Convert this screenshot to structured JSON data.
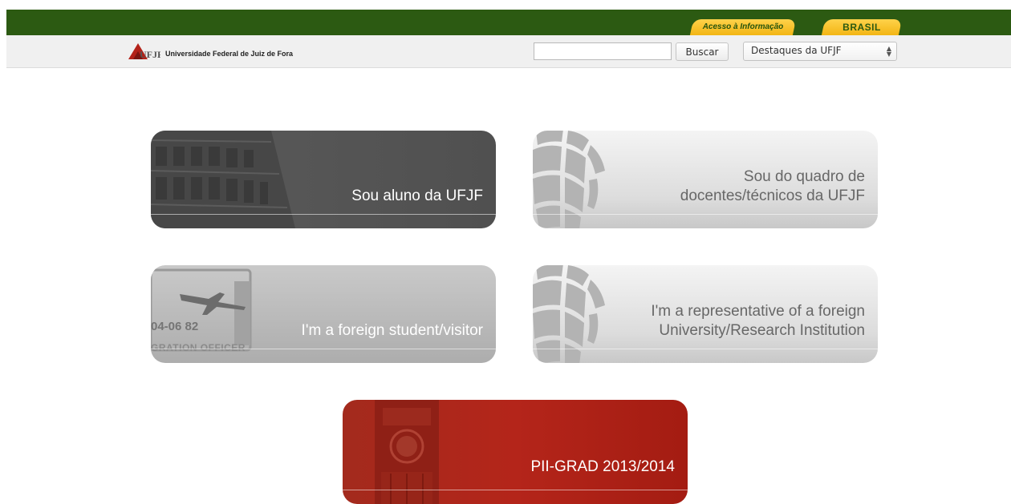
{
  "gov_bar": {
    "acesso_label": "Acesso à Informação",
    "brasil_label": "BRASIL",
    "bar_color": "#2c5a12",
    "tab_color": "#f6be22"
  },
  "header": {
    "logo_text": "UFJF",
    "university_name": "Universidade Federal de Juiz de Fora",
    "search": {
      "value": "",
      "placeholder": "",
      "button_label": "Buscar"
    },
    "select": {
      "selected": "Destaques da UFJF"
    }
  },
  "tiles": [
    {
      "caption_lines": [
        "Sou aluno da UFJF"
      ],
      "image": "building-icon"
    },
    {
      "caption_lines": [
        "Sou do quadro de",
        "docentes/técnicos da UFJF"
      ],
      "image": "globe-grid-icon"
    },
    {
      "caption_lines": [
        "I'm a foreign student/visitor"
      ],
      "image": "passport-stamp-icon",
      "stamp_lines": [
        "04-06 82",
        "GRATION OFFICER"
      ]
    },
    {
      "caption_lines": [
        "I'm a representative of a foreign",
        "University/Research Institution"
      ],
      "image": "globe-grid-icon"
    },
    {
      "caption_lines": [
        "PII-GRAD 2013/2014"
      ],
      "image": "big-ben-icon",
      "accent": "#b02518"
    }
  ]
}
